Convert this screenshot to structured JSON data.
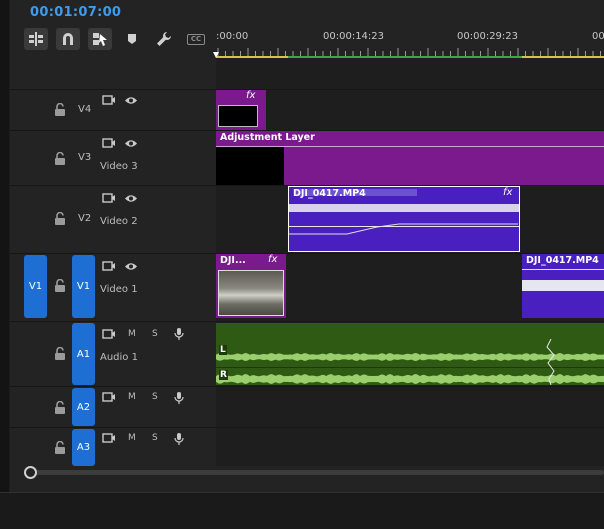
{
  "timecode": "00:01:07:00",
  "ruler": {
    "labels": [
      ":00:00",
      "00:00:14:23",
      "00:00:29:23",
      "00"
    ]
  },
  "colors": {
    "accent": "#3d9cf0",
    "target": "#1d6fd4",
    "clip_purple": "#7a1a8c",
    "clip_violet": "#4a1fc0",
    "audio_green": "#2f5a13",
    "work_yellow": "#d4c44a",
    "work_green": "#3ea83a"
  },
  "toolbar": {
    "icons": [
      "insert-sequence-icon",
      "snap-magnet-icon",
      "linked-selection-icon",
      "marker-icon",
      "wrench-icon",
      "captions-icon"
    ],
    "captions_label": "CC"
  },
  "tracks": {
    "v4": {
      "label": "V4",
      "name": ""
    },
    "v3": {
      "label": "V3",
      "name": "Video 3"
    },
    "v2": {
      "label": "V2",
      "name": "Video 2"
    },
    "v1": {
      "source": "V1",
      "label": "V1",
      "name": "Video 1"
    },
    "a1": {
      "label": "A1",
      "name": "Audio 1"
    },
    "a2": {
      "label": "A2",
      "name": ""
    },
    "a3": {
      "label": "A3",
      "name": ""
    }
  },
  "audio_controls": {
    "mute": "M",
    "solo": "S"
  },
  "clips": {
    "v4_clip": {
      "fx": "fx"
    },
    "v3_clip": {
      "title": "Adjustment Layer"
    },
    "v2_clip": {
      "title": "DJI_0417.MP4",
      "fx": "fx"
    },
    "v1_clip1": {
      "title": "DJI...",
      "fx": "fx"
    },
    "v1_clip2": {
      "title": "DJI_0417.MP4"
    },
    "a1_clip": {
      "left_channel": "L",
      "right_channel": "R"
    }
  }
}
